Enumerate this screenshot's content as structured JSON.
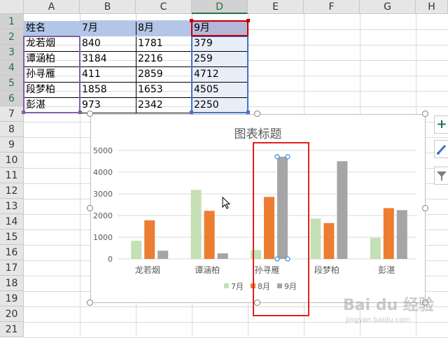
{
  "columns": [
    "A",
    "B",
    "C",
    "D",
    "E",
    "F",
    "G",
    "H"
  ],
  "rows": [
    "1",
    "2",
    "3",
    "4",
    "5",
    "6",
    "7",
    "8",
    "9",
    "10",
    "11",
    "12",
    "13",
    "14",
    "15",
    "16",
    "17",
    "18",
    "19",
    "20",
    "21"
  ],
  "table": {
    "header": [
      "姓名",
      "7月",
      "8月",
      "9月"
    ],
    "body": [
      [
        "龙若烟",
        "840",
        "1781",
        "379"
      ],
      [
        "谭涵柏",
        "3184",
        "2216",
        "259"
      ],
      [
        "孙寻雁",
        "411",
        "2859",
        "4712"
      ],
      [
        "段梦柏",
        "1858",
        "1653",
        "4505"
      ],
      [
        "彭湛",
        "973",
        "2342",
        "2250"
      ]
    ]
  },
  "chart_data": {
    "type": "bar",
    "title": "图表标题",
    "categories": [
      "龙若烟",
      "谭涵柏",
      "孙寻雁",
      "段梦柏",
      "彭湛"
    ],
    "series": [
      {
        "name": "7月",
        "values": [
          840,
          3184,
          411,
          1858,
          973
        ],
        "color": "#c5e0b4"
      },
      {
        "name": "8月",
        "values": [
          1781,
          2216,
          2859,
          1653,
          2342
        ],
        "color": "#ed7d31"
      },
      {
        "name": "9月",
        "values": [
          379,
          259,
          4712,
          4505,
          2250
        ],
        "color": "#a5a5a5"
      }
    ],
    "ylim": [
      0,
      5000
    ],
    "yticks": [
      "0",
      "1000",
      "2000",
      "3000",
      "4000",
      "5000"
    ],
    "grid": true,
    "legend_position": "bottom",
    "selected_point": {
      "series": "9月",
      "category": "孙寻雁"
    }
  },
  "side_buttons": {
    "add_glyph": "+",
    "style_glyph": "🖌",
    "filter_glyph": "▼"
  },
  "watermark": {
    "main": "Bai du 经验",
    "sub": "jingyan.baidu.com"
  }
}
